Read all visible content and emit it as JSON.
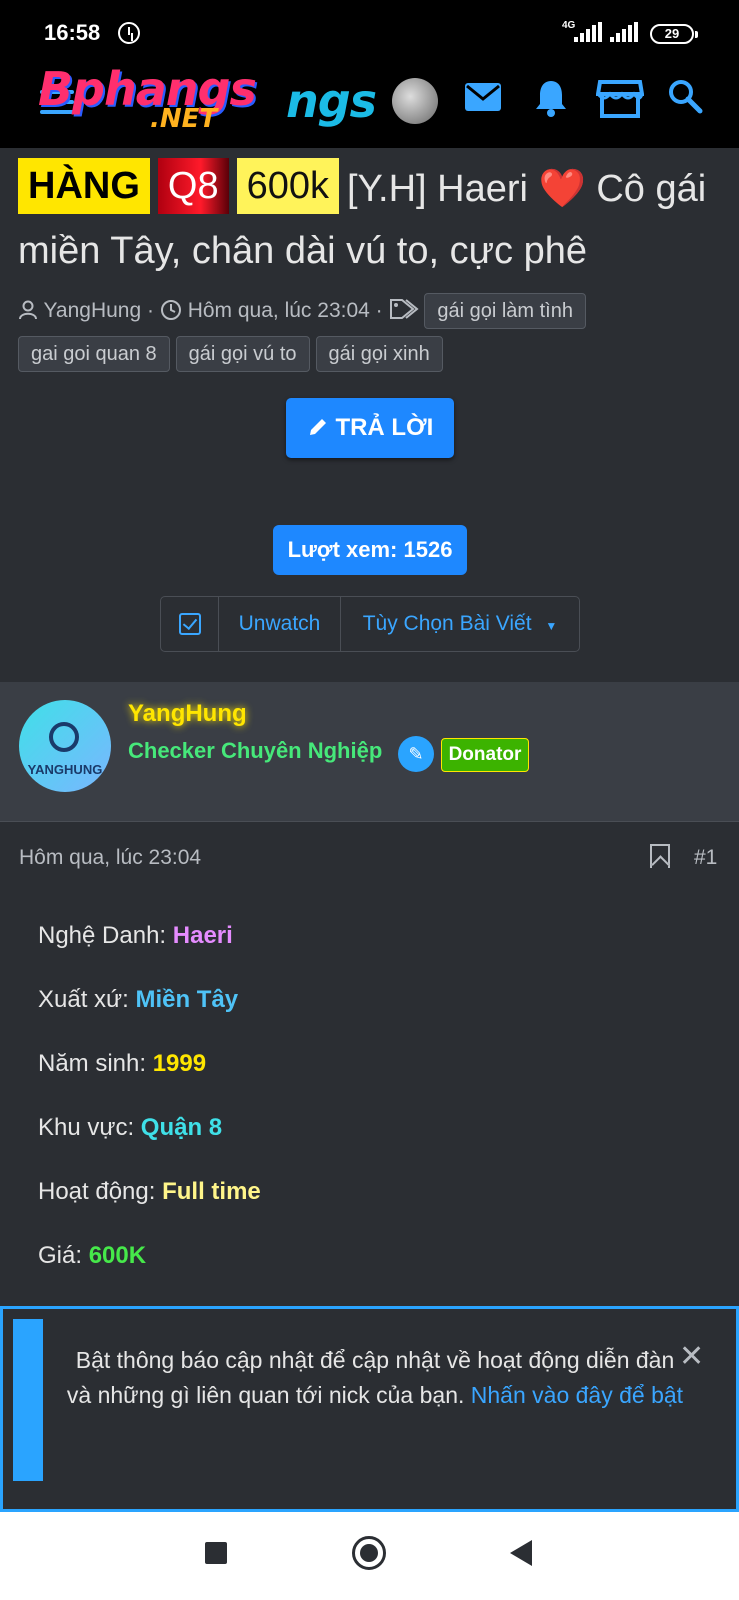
{
  "status_bar": {
    "time": "16:58",
    "network": "4G",
    "battery": "29"
  },
  "header": {
    "logo_main": "Bphangs",
    "logo_overlay": "ngs",
    "logo_suffix": ".NET",
    "icons": [
      "menu-icon",
      "avatar",
      "mail-icon",
      "bell-icon",
      "store-icon",
      "search-icon"
    ]
  },
  "thread": {
    "badges": [
      "HÀNG",
      "Q8",
      "600k"
    ],
    "title": "[Y.H] Haeri ❤️ Cô gái miền Tây, chân dài vú to, cực phê",
    "author": "YangHung",
    "separator": "·",
    "time": "Hôm qua, lúc 23:04",
    "tags": [
      "gái gọi làm tình",
      "gai goi quan 8",
      "gái gọi vú to",
      "gái gọi xinh"
    ]
  },
  "actions": {
    "reply_label": "TRẢ LỜI",
    "views_label": "Lượt xem: 1526",
    "unwatch_label": "Unwatch",
    "options_label": "Tùy Chọn Bài Viết"
  },
  "user": {
    "avatar_text": "YANGHUNG",
    "name": "YangHung",
    "rank": "Checker Chuyên Nghiệp",
    "badge": "Donator"
  },
  "post": {
    "time": "Hôm qua, lúc 23:04",
    "number": "#1",
    "fields": [
      {
        "label": "Nghệ Danh: ",
        "value": "Haeri",
        "color": "#e58cff"
      },
      {
        "label": "Xuất xứ: ",
        "value": "Miền Tây",
        "color": "#4fc3f7"
      },
      {
        "label": "Năm sinh: ",
        "value": "1999",
        "color": "#ffe600"
      },
      {
        "label": "Khu vực: ",
        "value": "Quận 8",
        "color": "#3fe0e8"
      },
      {
        "label": "Hoạt động: ",
        "value": "Full time",
        "color": "#fff58a"
      },
      {
        "label": "Giá: ",
        "value": "600K",
        "color": "#46e84a"
      }
    ]
  },
  "notice": {
    "text": "Bật thông báo cập nhật để cập nhật về hoạt động diễn đàn và những gì liên quan tới nick của bạn. ",
    "link": "Nhấn vào đây để bật",
    "close": "✕"
  },
  "colors": {
    "accent": "#1e88ff",
    "background": "#2b2e33",
    "panel": "#3a3e45"
  }
}
